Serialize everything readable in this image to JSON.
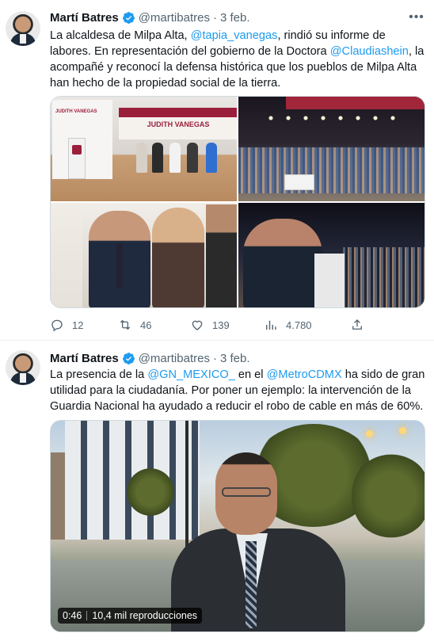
{
  "colors": {
    "accent": "#1d9bf0",
    "text": "#0f1419",
    "secondary": "#536471",
    "verified": "#1d9bf0"
  },
  "tweets": [
    {
      "author": {
        "name": "Martí Batres",
        "handle": "@martibatres"
      },
      "separator": "·",
      "date": "3 feb.",
      "text": {
        "p1": "La alcaldesa de Milpa Alta, ",
        "m1": "@tapia_vanegas",
        "p2": ", rindió su informe de labores. En representación del gobierno de la Doctora ",
        "m2": "@Claudiashein",
        "p3": ", la acompañé y reconocí la defensa histórica que los pueblos de Milpa Alta han hecho de la propiedad social de la tierra."
      },
      "photos": {
        "banner_text": "JUDITH VANEGAS",
        "panel_text": "JUDITH VANEGAS"
      },
      "actions": {
        "replies": "12",
        "retweets": "46",
        "likes": "139",
        "views": "4.780"
      }
    },
    {
      "author": {
        "name": "Martí Batres",
        "handle": "@martibatres"
      },
      "separator": "·",
      "date": "3 feb.",
      "text": {
        "p1": "La presencia de la ",
        "m1": "@GN_MEXICO_",
        "p2": " en el ",
        "m2": "@MetroCDMX",
        "p3": " ha sido de gran utilidad para la ciudadanía. Por poner un ejemplo: la intervención de la Guardia Nacional ha ayudado a reducir el robo de cable en más de 60%."
      },
      "video": {
        "duration": "0:46",
        "views": "10,4 mil reproducciones"
      }
    }
  ]
}
